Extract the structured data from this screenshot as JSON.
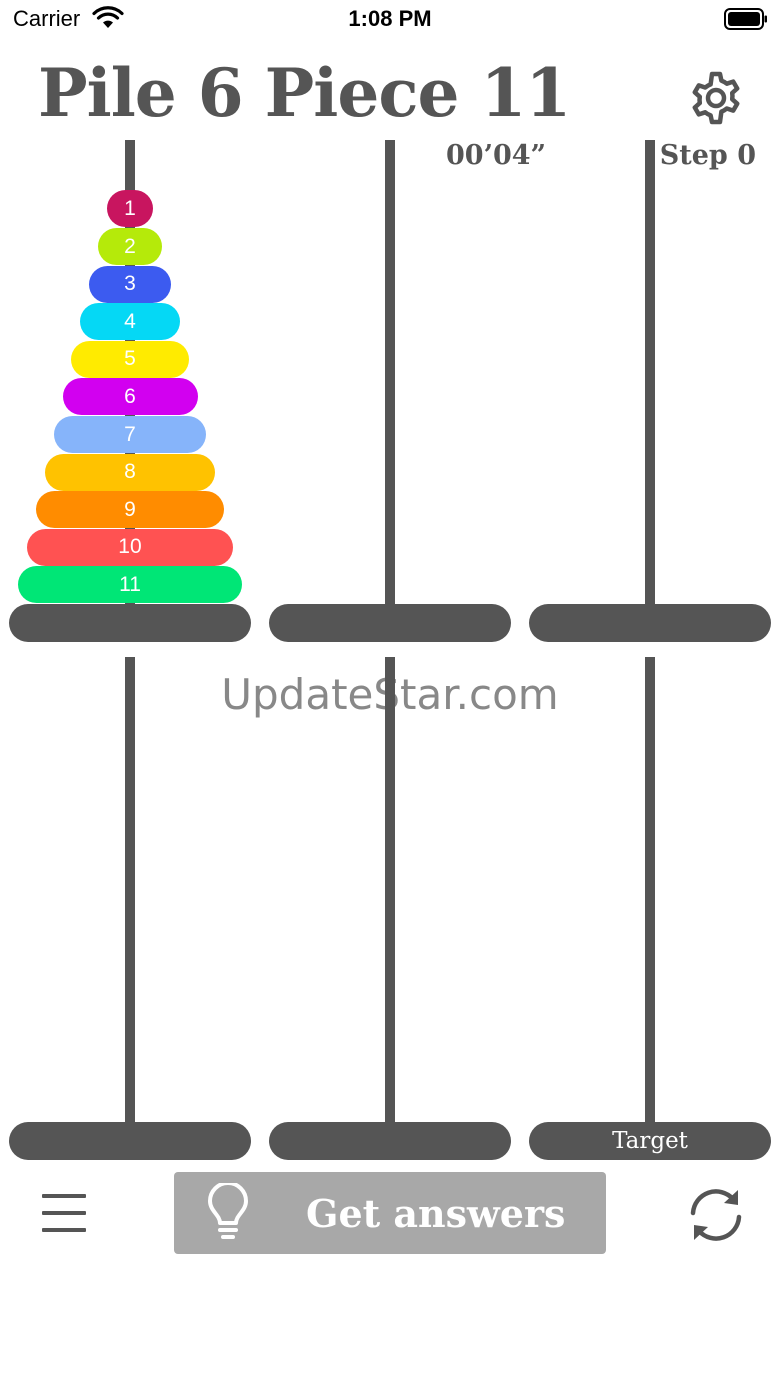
{
  "status_bar": {
    "carrier": "Carrier",
    "time": "1:08 PM"
  },
  "header": {
    "title": "Pile 6 Piece 11",
    "timer": "00’04”",
    "steps": "Step 0"
  },
  "board": {
    "top_row": {
      "pegs": [
        {
          "disks": [
            {
              "label": "1",
              "color": "#c8155f"
            },
            {
              "label": "2",
              "color": "#b5ea0a"
            },
            {
              "label": "3",
              "color": "#3c5bf0"
            },
            {
              "label": "4",
              "color": "#05d8f5"
            },
            {
              "label": "5",
              "color": "#ffeb00"
            },
            {
              "label": "6",
              "color": "#d200f0"
            },
            {
              "label": "7",
              "color": "#86b4fa"
            },
            {
              "label": "8",
              "color": "#ffc200"
            },
            {
              "label": "9",
              "color": "#ff8c00"
            },
            {
              "label": "10",
              "color": "#ff5252"
            },
            {
              "label": "11",
              "color": "#00e676"
            }
          ]
        },
        {
          "disks": []
        },
        {
          "disks": []
        }
      ]
    },
    "bottom_row": {
      "pegs": [
        {
          "disks": []
        },
        {
          "disks": []
        },
        {
          "disks": [],
          "base_label": "Target"
        }
      ]
    },
    "rod_color": "#555555"
  },
  "watermark": "UpdateStar.com",
  "toolbar": {
    "menu_icon": "hamburger-menu-icon",
    "answers_icon": "lightbulb-icon",
    "answers_label": "Get answers",
    "answers_bg": "#a8a8a8",
    "reset_icon": "refresh-icon"
  }
}
